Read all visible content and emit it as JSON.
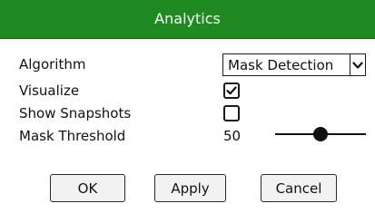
{
  "dialog": {
    "title": "Analytics",
    "title_bar_color": "#1f8a1f"
  },
  "fields": {
    "algorithm": {
      "label": "Algorithm",
      "selected": "Mask Detection"
    },
    "visualize": {
      "label": "Visualize",
      "checked": true
    },
    "show_snapshots": {
      "label": "Show Snapshots",
      "checked": false
    },
    "mask_threshold": {
      "label": "Mask Threshold",
      "value": "50",
      "slider_fraction": 0.5
    }
  },
  "buttons": {
    "ok": "OK",
    "apply": "Apply",
    "cancel": "Cancel"
  },
  "icons": {
    "dropdown": "chevron-down-icon",
    "check": "check-icon"
  }
}
